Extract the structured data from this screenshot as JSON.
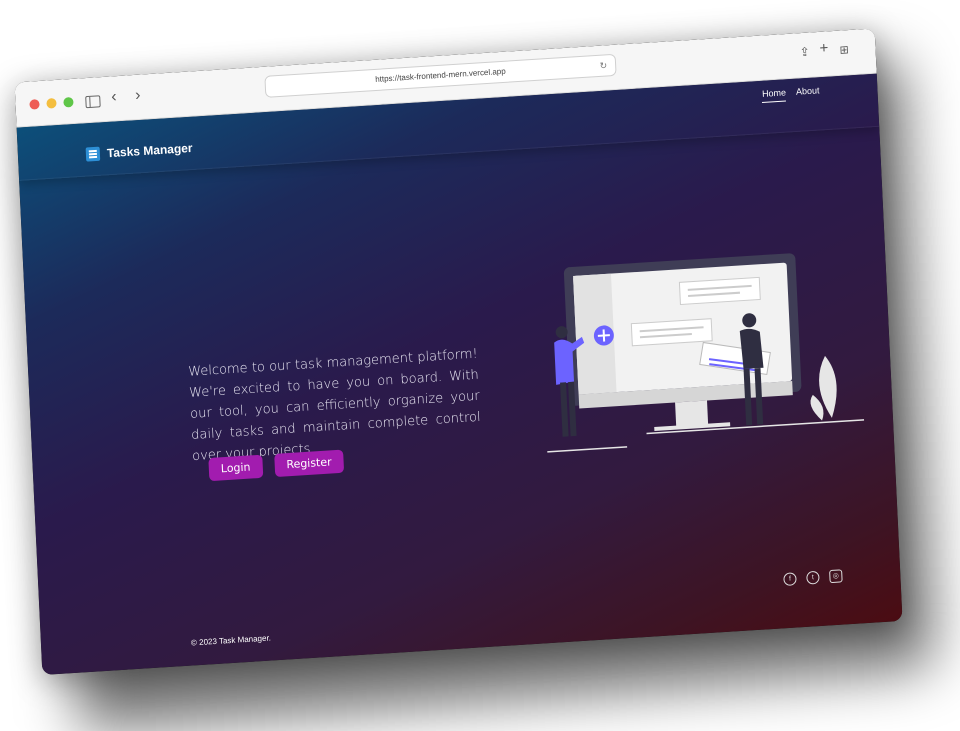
{
  "browser": {
    "url": "https://task-frontend-mern.vercel.app",
    "icons": [
      "sidebar-icon",
      "back-icon",
      "forward-icon",
      "reload-icon",
      "share-icon",
      "new-tab-icon",
      "tab-overview-icon"
    ]
  },
  "navbar": {
    "brand": "Tasks Manager",
    "links": [
      {
        "label": "Home",
        "active": true
      },
      {
        "label": "About",
        "active": false
      }
    ]
  },
  "hero": {
    "text": "Welcome to our task management platform! We're excited to have you on board. With our tool, you can efficiently organize your daily tasks and maintain complete control over your projects.",
    "login_label": "Login",
    "register_label": "Register"
  },
  "footer": {
    "copyright": "© 2023 Task Manager.",
    "socials": [
      "facebook-icon",
      "twitter-icon",
      "instagram-icon"
    ]
  },
  "colors": {
    "accent": "#a21caf",
    "gradient_start": "#0c4f7a",
    "gradient_end": "#4b0c12"
  }
}
